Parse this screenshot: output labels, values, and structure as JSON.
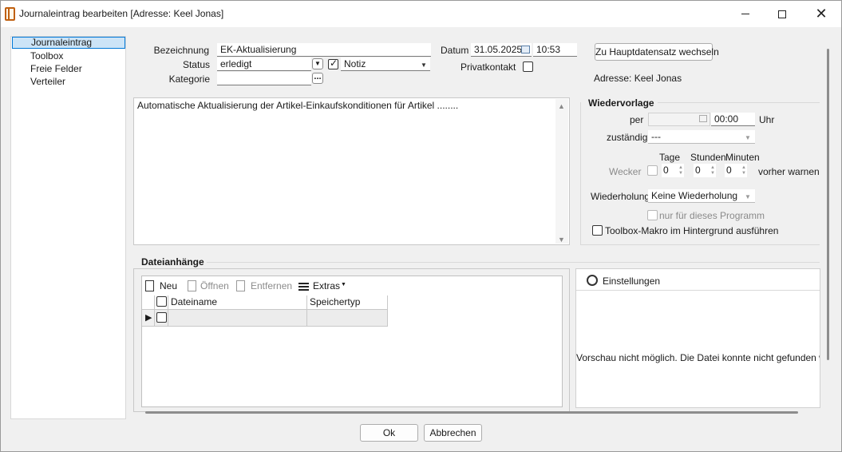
{
  "window": {
    "title": "Journaleintrag bearbeiten [Adresse: Keel Jonas]",
    "close_glyph": "✕"
  },
  "nav": {
    "items": [
      {
        "label": "Journaleintrag",
        "selected": true
      },
      {
        "label": "Toolbox"
      },
      {
        "label": "Freie Felder"
      },
      {
        "label": "Verteiler"
      }
    ]
  },
  "form": {
    "bezeichnung_label": "Bezeichnung",
    "bezeichnung_value": "EK-Aktualisierung",
    "status_label": "Status",
    "status_value": "erledigt",
    "notiz_value": "Notiz",
    "kategorie_label": "Kategorie",
    "kategorie_btn": "...",
    "datum_label": "Datum",
    "datum_value": "31.05.2025",
    "time_value": "10:53",
    "privatkontakt_label": "Privatkontakt",
    "switch_btn": "Zu Hauptdatensatz wechseln",
    "adresse_text": "Adresse: Keel Jonas",
    "note_text": "Automatische Aktualisierung der Artikel-Einkaufskonditionen für Artikel ........"
  },
  "wiedervorlage": {
    "title": "Wiedervorlage",
    "per_label": "per",
    "time_value": "00:00",
    "uhr_label": "Uhr",
    "zustaendig_label": "zuständig",
    "zustaendig_value": "---",
    "tage_label": "Tage",
    "stunden_label": "Stunden",
    "minuten_label": "Minuten",
    "wecker_label": "Wecker",
    "tage_value": "0",
    "stunden_value": "0",
    "minuten_value": "0",
    "vorher_label": "vorher warnen",
    "wiederholung_label": "Wiederholung",
    "wiederholung_value": "Keine Wiederholung",
    "nur_programm_label": "nur für dieses Programm",
    "toolbox_makro_label": "Toolbox-Makro im Hintergrund ausführen"
  },
  "attachments": {
    "title": "Dateianhänge",
    "neu": "Neu",
    "oeffnen": "Öffnen",
    "entfernen": "Entfernen",
    "extras": "Extras",
    "col_name": "Dateiname",
    "col_type": "Speichertyp"
  },
  "preview": {
    "settings_label": "Einstellungen",
    "message": "Vorschau nicht möglich. Die Datei konnte nicht gefunden werden"
  },
  "footer": {
    "ok": "Ok",
    "cancel": "Abbrechen"
  }
}
